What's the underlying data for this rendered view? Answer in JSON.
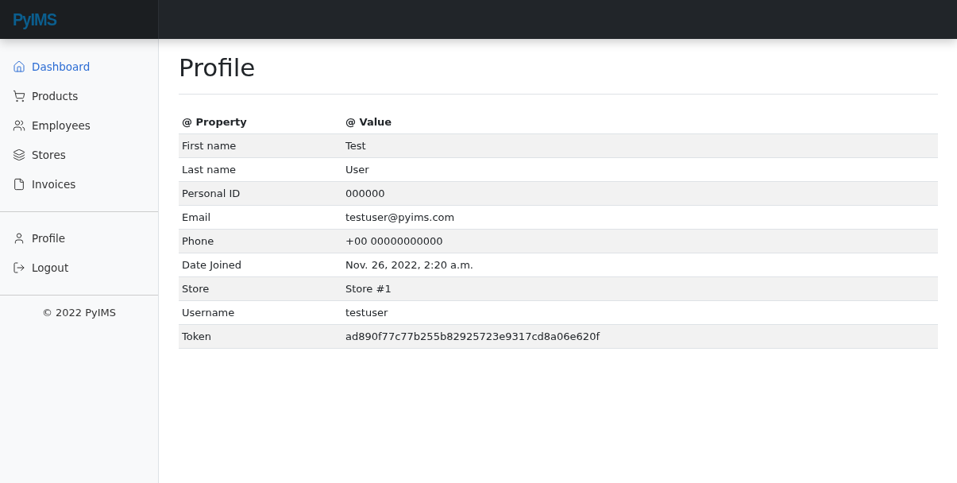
{
  "logo": {
    "text": "PyIMS"
  },
  "sidebar": {
    "items": [
      {
        "label": "Dashboard",
        "selected": true
      },
      {
        "label": "Products",
        "selected": false
      },
      {
        "label": "Employees",
        "selected": false
      },
      {
        "label": "Stores",
        "selected": false
      },
      {
        "label": "Invoices",
        "selected": false
      }
    ],
    "account_items": [
      {
        "label": "Profile",
        "selected": false
      },
      {
        "label": "Logout",
        "selected": false
      }
    ],
    "footer": "© 2022 PyIMS"
  },
  "page": {
    "title": "Profile"
  },
  "table": {
    "columns": [
      "@ Property",
      "@ Value"
    ],
    "rows": [
      [
        "First name",
        "Test"
      ],
      [
        "Last name",
        "User"
      ],
      [
        "Personal ID",
        "000000"
      ],
      [
        "Email",
        "testuser@pyims.com"
      ],
      [
        "Phone",
        "+00 00000000000"
      ],
      [
        "Date Joined",
        "Nov. 26, 2022, 2:20 a.m."
      ],
      [
        "Store",
        "Store #1"
      ],
      [
        "Username",
        "testuser"
      ],
      [
        "Token",
        "ad890f77c77b255b82925723e9317cd8a06e620f"
      ]
    ]
  }
}
